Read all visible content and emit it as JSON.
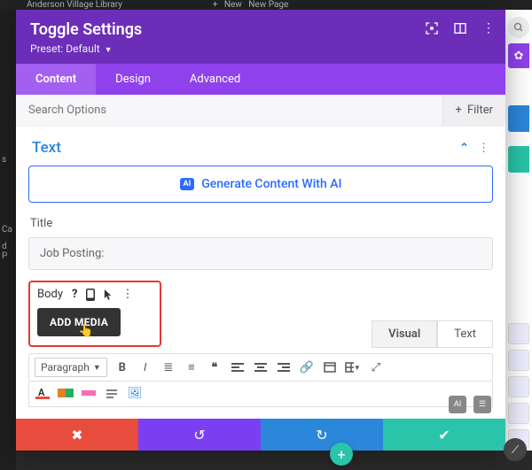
{
  "backdrop": {
    "top_text": "Anderson Village Library",
    "top_new": "New",
    "top_newpage": "New Page",
    "left_labels": [
      "s",
      "Ca",
      "d P"
    ]
  },
  "header": {
    "title": "Toggle Settings",
    "preset_prefix": "Preset:",
    "preset_value": "Default"
  },
  "tabs": {
    "content": "Content",
    "design": "Design",
    "advanced": "Advanced"
  },
  "search": {
    "placeholder": "Search Options",
    "filter": "Filter"
  },
  "section": {
    "title": "Text"
  },
  "ai_button": {
    "badge": "AI",
    "label": "Generate Content With AI"
  },
  "title_field": {
    "label": "Title",
    "value": "Job Posting:"
  },
  "body_field": {
    "label": "Body",
    "add_media": "ADD MEDIA"
  },
  "editor_tabs": {
    "visual": "Visual",
    "text": "Text"
  },
  "format_select": "Paragraph",
  "corner": {
    "ai": "AI"
  }
}
